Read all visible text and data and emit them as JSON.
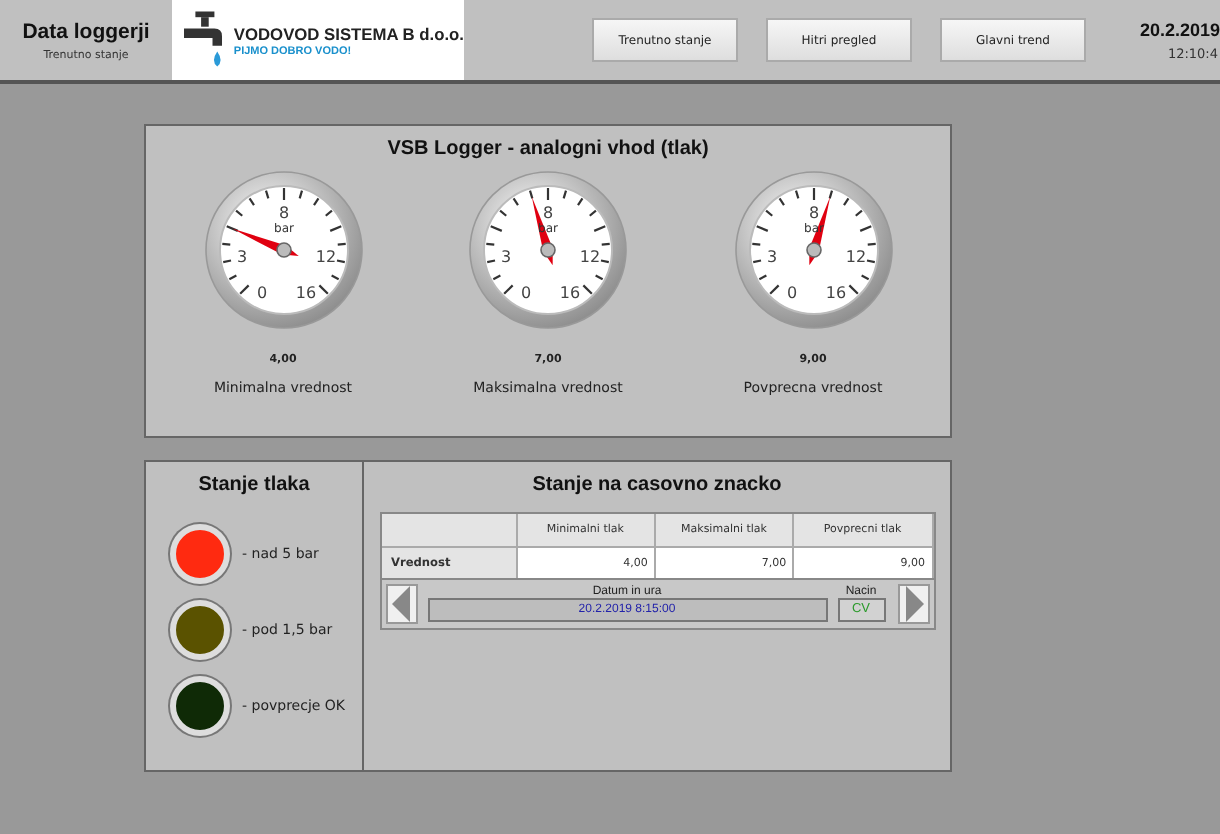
{
  "header": {
    "title": "Data loggerji",
    "subtitle": "Trenutno stanje",
    "company": "VODOVOD SISTEMA B d.o.o.",
    "slogan": "PIJMO DOBRO VODO!",
    "nav": [
      {
        "label": "Trenutno stanje"
      },
      {
        "label": "Hitri pregled"
      },
      {
        "label": "Glavni trend"
      }
    ],
    "date": "20.2.2019",
    "time": "12:10:4"
  },
  "gauge_panel": {
    "title": "VSB Logger - analogni vhod (tlak)",
    "gauges": [
      {
        "reading": "4,00",
        "label": "Minimalna vrednost",
        "level": 0.25,
        "scale": [
          "0",
          "3",
          "8",
          "12",
          "16"
        ],
        "unit": "bar"
      },
      {
        "reading": "7,00",
        "label": "Maksimalna vrednost",
        "level": 0.4375,
        "scale": [
          "0",
          "3",
          "8",
          "12",
          "16"
        ],
        "unit": "bar"
      },
      {
        "reading": "9,00",
        "label": "Povprecna vrednost",
        "level": 0.5625,
        "scale": [
          "0",
          "3",
          "8",
          "12",
          "16"
        ],
        "unit": "bar"
      }
    ]
  },
  "status_panel": {
    "title": "Stanje tlaka",
    "lamps": [
      {
        "label": "- nad 5 bar",
        "color": "#ff2a10"
      },
      {
        "label": "- pod 1,5 bar",
        "color": "#5a5200"
      },
      {
        "label": "- povprecje OK",
        "color": "#0f2a06"
      }
    ]
  },
  "time_panel": {
    "title": "Stanje na casovno znacko",
    "columns": [
      "Minimalni tlak",
      "Maksimalni tlak",
      "Povprecni tlak"
    ],
    "rows": [
      {
        "label": "Vrednost",
        "cells": [
          "4,00",
          "7,00",
          "9,00"
        ]
      }
    ],
    "datetime_label": "Datum in ura",
    "datetime": "20.2.2019 8:15:00",
    "mode_label": "Nacin",
    "mode": "CV"
  }
}
